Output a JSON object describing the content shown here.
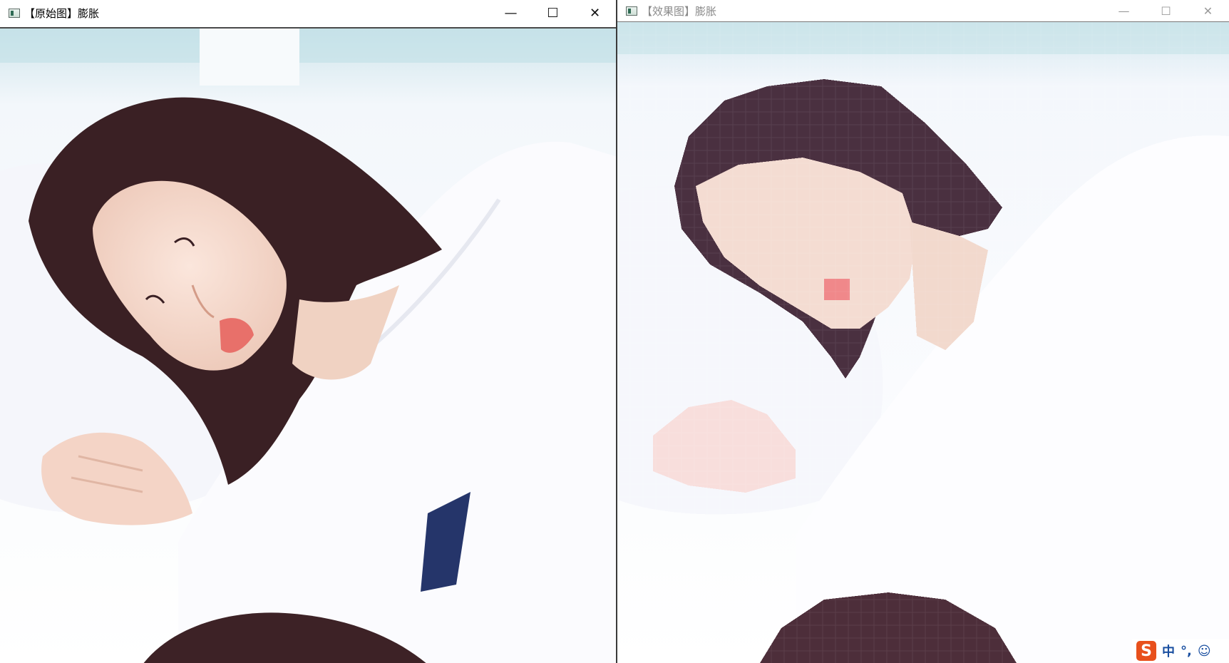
{
  "left_window": {
    "title": "【原始图】膨胀",
    "controls": {
      "minimize": "—",
      "maximize": "☐",
      "close": "✕"
    }
  },
  "right_window": {
    "title": "【效果图】膨胀",
    "controls": {
      "minimize": "—",
      "maximize": "☐",
      "close": "✕"
    }
  },
  "ime_bar": {
    "logo": "S",
    "mode": "中",
    "punct": "°,",
    "emoji": "☺",
    "mic": "🎤"
  },
  "colors": {
    "hair": "#3a2024",
    "skin": "#f2d5c8",
    "pillow": "#f4f6fb",
    "background": "#eaf3f6",
    "window_frame": "#4a4a4a",
    "ime_logo": "#e8501c"
  },
  "icons": [
    "app-icon",
    "minimize-icon",
    "maximize-icon",
    "close-icon",
    "sogou-logo-icon"
  ]
}
